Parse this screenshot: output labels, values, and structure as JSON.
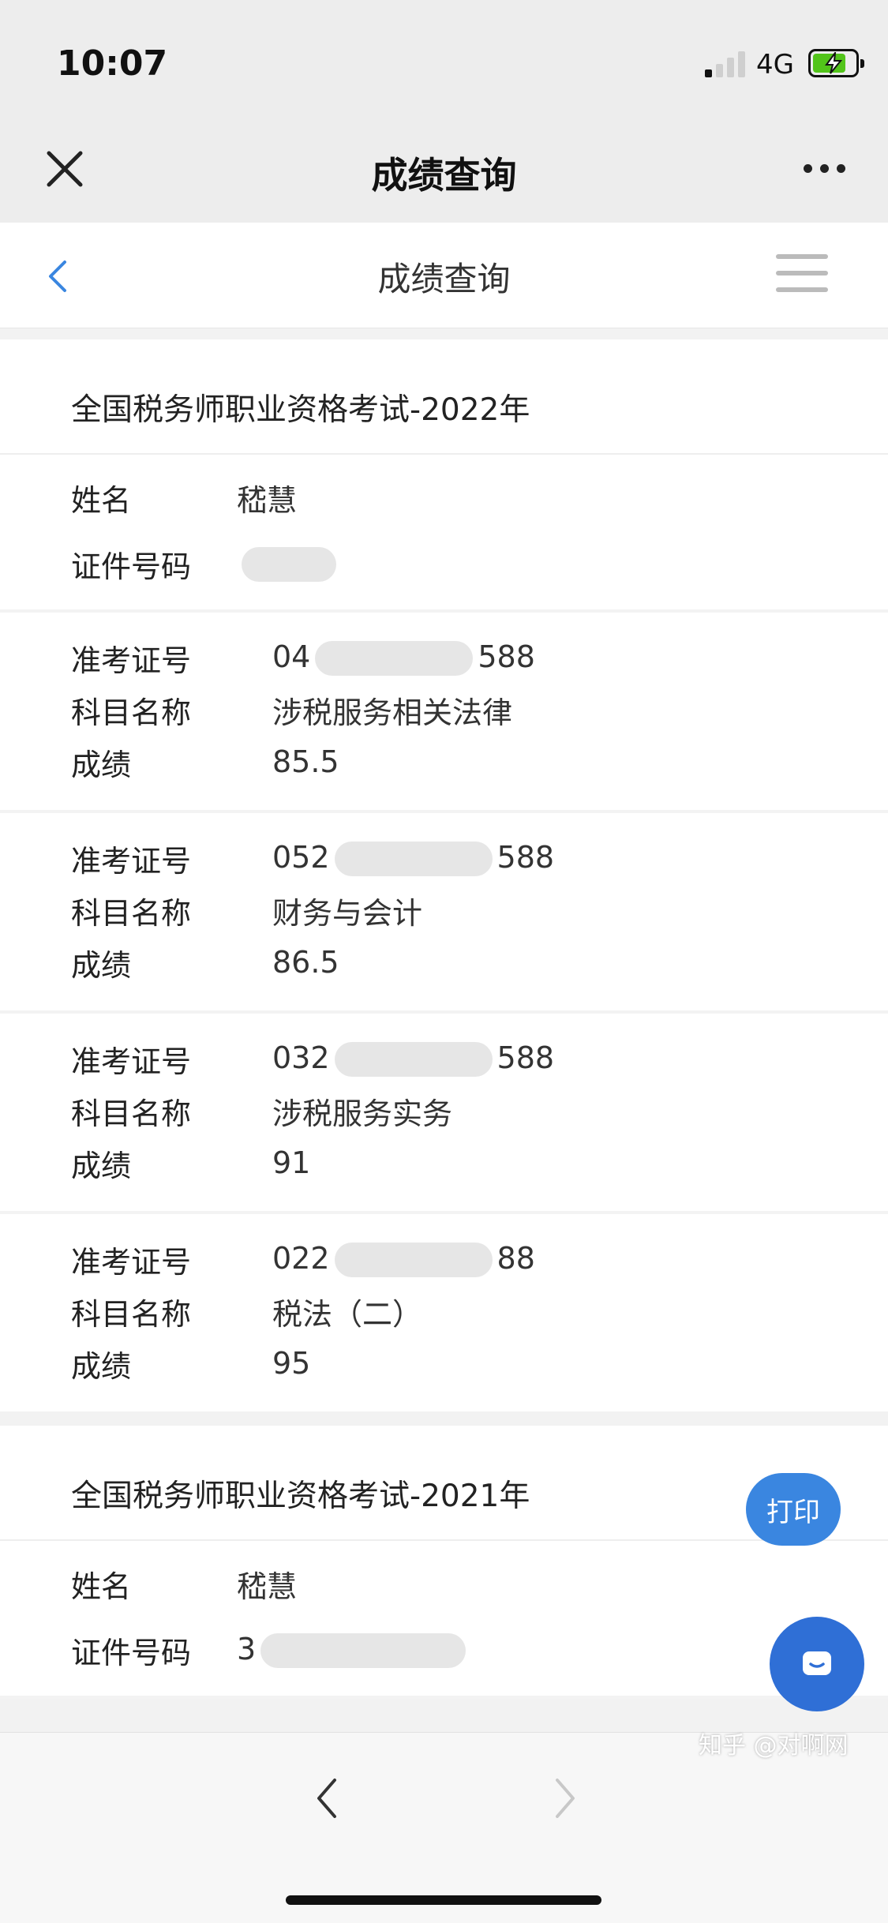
{
  "status_bar": {
    "time": "10:07",
    "network": "4G"
  },
  "wechat_bar": {
    "title": "成绩查询"
  },
  "page_header": {
    "title": "成绩查询"
  },
  "exams": [
    {
      "title": "全国税务师职业资格考试-2022年",
      "name_label": "姓名",
      "name_value": "嵇慧",
      "id_label": "证件号码",
      "id_value": "",
      "subjects": [
        {
          "ticket_label": "准考证号",
          "ticket_prefix": "04",
          "ticket_suffix": "588",
          "subject_label": "科目名称",
          "subject_value": "涉税服务相关法律",
          "score_label": "成绩",
          "score_value": "85.5"
        },
        {
          "ticket_label": "准考证号",
          "ticket_prefix": "052",
          "ticket_suffix": "588",
          "subject_label": "科目名称",
          "subject_value": "财务与会计",
          "score_label": "成绩",
          "score_value": "86.5"
        },
        {
          "ticket_label": "准考证号",
          "ticket_prefix": "032",
          "ticket_suffix": "588",
          "subject_label": "科目名称",
          "subject_value": "涉税服务实务",
          "score_label": "成绩",
          "score_value": "91"
        },
        {
          "ticket_label": "准考证号",
          "ticket_prefix": "022",
          "ticket_suffix": "88",
          "subject_label": "科目名称",
          "subject_value": "税法（二）",
          "score_label": "成绩",
          "score_value": "95"
        }
      ]
    },
    {
      "title": "全国税务师职业资格考试-2021年",
      "name_label": "姓名",
      "name_value": "嵇慧",
      "id_label": "证件号码",
      "id_value": "3"
    }
  ],
  "buttons": {
    "print_label": "打印"
  },
  "watermark": {
    "text": "知乎 @对啊网"
  },
  "colors": {
    "accent": "#3a86e0",
    "chat_button": "#2f6fd6",
    "battery": "#52c41a"
  }
}
